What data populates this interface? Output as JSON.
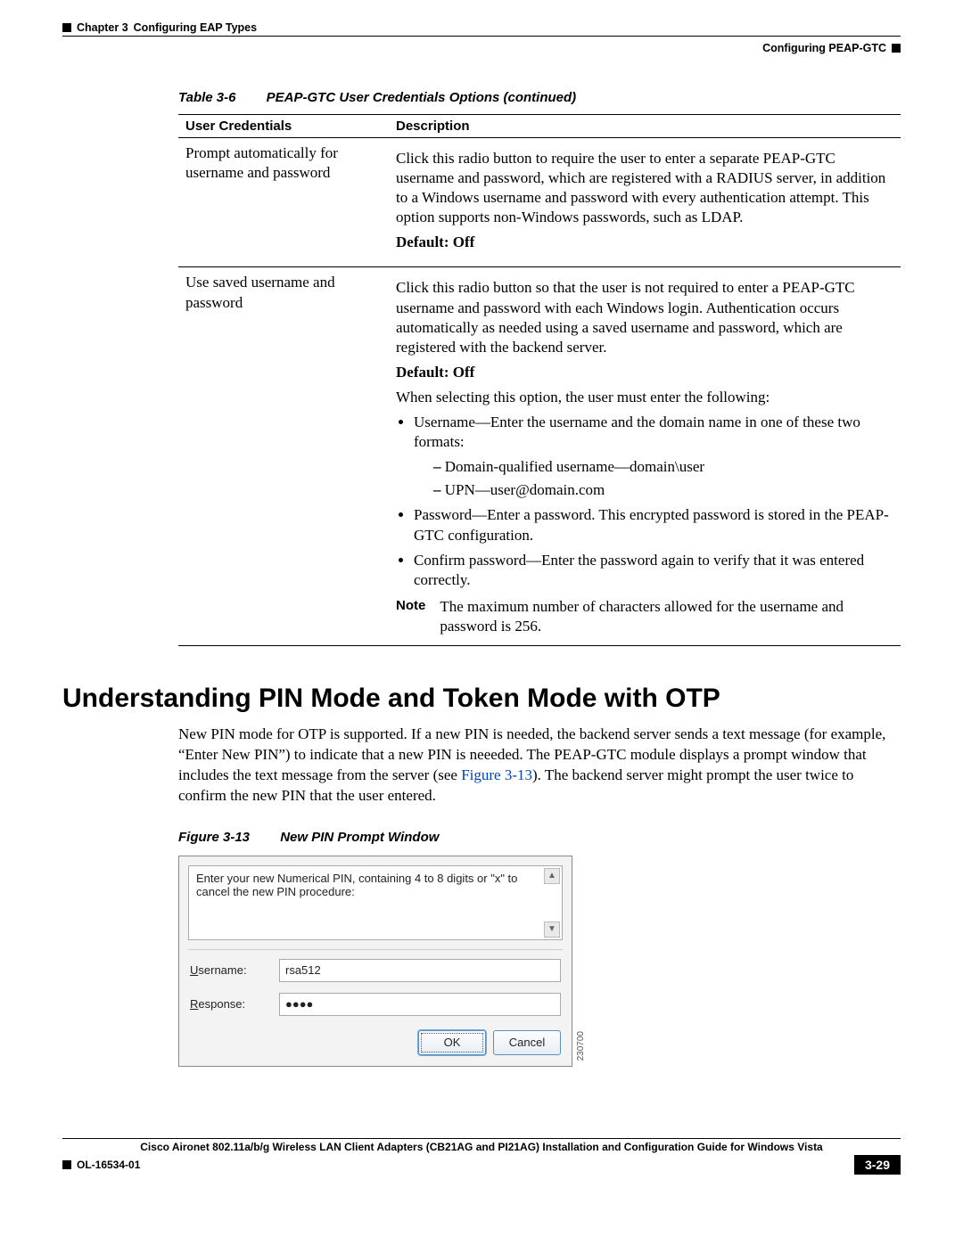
{
  "header": {
    "chapter_label": "Chapter 3",
    "chapter_title": "Configuring EAP Types",
    "section_title": "Configuring PEAP-GTC"
  },
  "table": {
    "caption_num": "Table 3-6",
    "caption_text": "PEAP-GTC User Credentials Options (continued)",
    "col1": "User Credentials",
    "col2": "Description",
    "rows": [
      {
        "name": "Prompt automatically for username and password",
        "desc": "Click this radio button to require the user to enter a separate PEAP-GTC username and password, which are registered with a RADIUS server, in addition to a Windows username and password with every authentication attempt. This option supports non-Windows passwords, such as LDAP.",
        "default": "Default: Off"
      },
      {
        "name": "Use saved username and password",
        "desc": "Click this radio button so that the user is not required to enter a PEAP-GTC username and password with each Windows login. Authentication occurs automatically as needed using a saved username and password, which are registered with the backend server.",
        "default": "Default: Off",
        "select_intro": "When selecting this option, the user must enter the following:",
        "bullets": {
          "username": "Username—Enter the username and the domain name in one of these two formats:",
          "dq": "Domain-qualified username—domain\\user",
          "upn": "UPN—user@domain.com",
          "password": "Password—Enter a password. This encrypted password is stored in the PEAP-GTC configuration.",
          "confirm": "Confirm password—Enter the password again to verify that it was entered correctly."
        },
        "note_label": "Note",
        "note_text": "The maximum number of characters allowed for the username and password is 256."
      }
    ]
  },
  "section_heading": "Understanding PIN Mode and Token Mode with OTP",
  "body_text_a": "New PIN mode for OTP is supported. If a new PIN is needed, the backend server sends a text message (for example, “Enter New PIN”) to indicate that a new PIN is neeeded. The PEAP-GTC module displays a prompt window that includes the text message from the server (see ",
  "body_text_xref": "Figure 3-13",
  "body_text_b": "). The backend server might prompt the user twice to confirm the new PIN that the user entered.",
  "figure": {
    "caption_num": "Figure 3-13",
    "caption_text": "New PIN Prompt Window",
    "side_code": "230700"
  },
  "dialog": {
    "message": "Enter your new Numerical PIN, containing 4 to 8 digits or \"x\" to cancel the new PIN procedure:",
    "username_label_initial": "U",
    "username_label_rest": "sername:",
    "username_value": "rsa512",
    "response_label_initial": "R",
    "response_label_rest": "esponse:",
    "response_value": "●●●●",
    "ok": "OK",
    "cancel": "Cancel"
  },
  "footer": {
    "book": "Cisco Aironet 802.11a/b/g Wireless LAN Client Adapters (CB21AG and PI21AG) Installation and Configuration Guide for Windows Vista",
    "ol": "OL-16534-01",
    "page": "3-29"
  }
}
